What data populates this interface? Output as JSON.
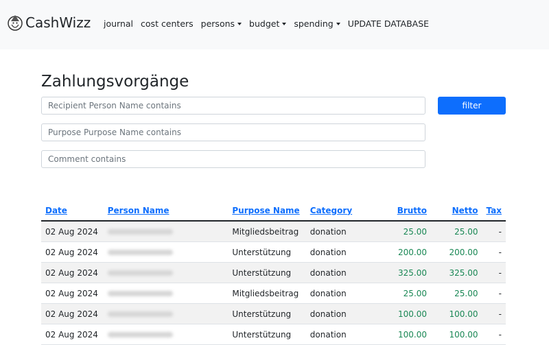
{
  "app": {
    "name": "CashWizz"
  },
  "nav": [
    {
      "label": "journal",
      "dropdown": false
    },
    {
      "label": "cost centers",
      "dropdown": false
    },
    {
      "label": "persons",
      "dropdown": true
    },
    {
      "label": "budget",
      "dropdown": true
    },
    {
      "label": "spending",
      "dropdown": true
    },
    {
      "label": "UPDATE DATABASE",
      "dropdown": false
    }
  ],
  "page": {
    "title": "Zahlungsvorgänge"
  },
  "filters": {
    "recipient_placeholder": "Recipient Person Name contains",
    "purpose_placeholder": "Purpose Purpose Name contains",
    "comment_placeholder": "Comment contains",
    "recipient_value": "",
    "purpose_value": "",
    "comment_value": "",
    "filter_button": "filter"
  },
  "table": {
    "headers": {
      "date": "Date",
      "person": "Person Name",
      "purpose": "Purpose Name",
      "category": "Category",
      "brutto": "Brutto",
      "netto": "Netto",
      "tax": "Tax"
    },
    "rows": [
      {
        "date": "02 Aug 2024",
        "person": "",
        "purpose": "Mitgliedsbeitrag",
        "category": "donation",
        "brutto": "25.00",
        "netto": "25.00",
        "tax": "-"
      },
      {
        "date": "02 Aug 2024",
        "person": "",
        "purpose": "Unterstützung",
        "category": "donation",
        "brutto": "200.00",
        "netto": "200.00",
        "tax": "-"
      },
      {
        "date": "02 Aug 2024",
        "person": "",
        "purpose": "Unterstützung",
        "category": "donation",
        "brutto": "325.00",
        "netto": "325.00",
        "tax": "-"
      },
      {
        "date": "02 Aug 2024",
        "person": "",
        "purpose": "Mitgliedsbeitrag",
        "category": "donation",
        "brutto": "25.00",
        "netto": "25.00",
        "tax": "-"
      },
      {
        "date": "02 Aug 2024",
        "person": "",
        "purpose": "Unterstützung",
        "category": "donation",
        "brutto": "100.00",
        "netto": "100.00",
        "tax": "-"
      },
      {
        "date": "02 Aug 2024",
        "person": "",
        "purpose": "Unterstützung",
        "category": "donation",
        "brutto": "100.00",
        "netto": "100.00",
        "tax": "-"
      }
    ]
  },
  "colors": {
    "navbar_bg": "#f8f9fa",
    "primary": "#0d6efd",
    "amount_green": "#198754",
    "stripe": "#f2f2f2"
  },
  "icons": {
    "logo": "wizard-logo-icon",
    "dropdown": "caret-down-icon",
    "redacted": "redacted-name"
  }
}
